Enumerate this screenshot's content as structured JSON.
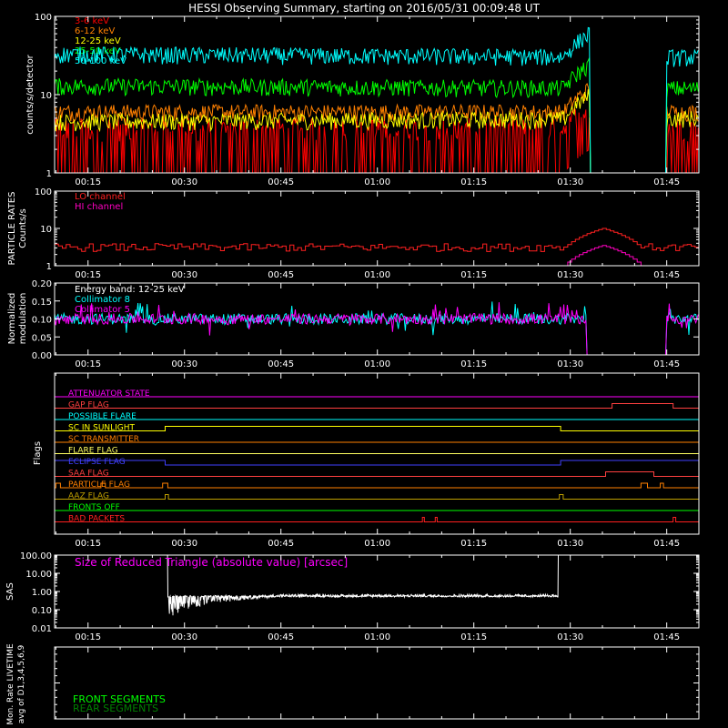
{
  "title": "HESSI Observing Summary, starting on 2016/05/31 00:09:48 UT",
  "time_ticks": [
    "00:15",
    "00:30",
    "00:45",
    "01:00",
    "01:15",
    "01:30",
    "01:45"
  ],
  "chart_data": [
    {
      "type": "line",
      "name": "counts",
      "ylabel": "counts/s/detector",
      "yscale": "log",
      "ylim": [
        1,
        100
      ],
      "yticks": [
        "1",
        "10",
        "100"
      ],
      "legend": "top-left",
      "data_gaps": [
        [
          "01:33",
          "01:45"
        ]
      ],
      "series": [
        {
          "name": "3-6 keV",
          "color": "#ff0000",
          "level_start": 2.5,
          "level_end": 2.5
        },
        {
          "name": "6-12 keV",
          "color": "#ff8000",
          "level_start": 6.0,
          "level_end": 6.0
        },
        {
          "name": "12-25 keV",
          "color": "#ffff00",
          "level_start": 4.5,
          "level_end": 5.0
        },
        {
          "name": "25-50 keV",
          "color": "#00ff00",
          "level_start": 13,
          "level_end": 12
        },
        {
          "name": "50-100 keV",
          "color": "#00ffff",
          "level_start": 33,
          "level_end": 30
        }
      ]
    },
    {
      "type": "line",
      "name": "particle-rates",
      "ylabel": "PARTICLE RATES",
      "ylabel2": "Counts/s",
      "yscale": "log",
      "ylim": [
        1,
        100
      ],
      "yticks": [
        "1",
        "10",
        "100"
      ],
      "legend": "top-left",
      "series": [
        {
          "name": "LO channel",
          "color": "#ff2020",
          "baseline": 3.0,
          "peak": 10.0,
          "peak_time": "01:35"
        },
        {
          "name": "HI channel",
          "color": "#ff00c0",
          "baseline": 1.0,
          "peak": 3.5,
          "peak_time": "01:35"
        }
      ]
    },
    {
      "type": "line",
      "name": "modulation",
      "ylabel": "Normalized",
      "ylabel2": "modulation",
      "ylim": [
        0,
        0.2
      ],
      "yticks": [
        "0.00",
        "0.05",
        "0.10",
        "0.15",
        "0.20"
      ],
      "annotation": "Energy band: 12-25 keV",
      "series": [
        {
          "name": "Collimator 8",
          "color": "#00ffff",
          "mean": 0.1
        },
        {
          "name": "Collimator 5",
          "color": "#ff00ff",
          "mean": 0.1
        }
      ]
    },
    {
      "type": "flags",
      "name": "flags",
      "ylabel": "Flags",
      "flags": [
        {
          "name": "ATTENUATOR STATE",
          "color": "#ff00ff"
        },
        {
          "name": "GAP FLAG",
          "color": "#ff4040"
        },
        {
          "name": "POSSIBLE FLARE",
          "color": "#00ffff"
        },
        {
          "name": "SC IN SUNLIGHT",
          "color": "#ffff00"
        },
        {
          "name": "SC TRANSMITTER",
          "color": "#ff8000"
        },
        {
          "name": "FLARE FLAG",
          "color": "#ffff60"
        },
        {
          "name": "ECLIPSE FLAG",
          "color": "#4040ff"
        },
        {
          "name": "SAA FLAG",
          "color": "#ff4040"
        },
        {
          "name": "PARTICLE FLAG",
          "color": "#ff8000"
        },
        {
          "name": "AAZ FLAG",
          "color": "#c0a000"
        },
        {
          "name": "FRONTS OFF",
          "color": "#00ff00"
        },
        {
          "name": "BAD PACKETS",
          "color": "#ff2020"
        }
      ]
    },
    {
      "type": "line",
      "name": "sas",
      "ylabel": "SAS",
      "yscale": "log",
      "ylim": [
        0.01,
        100
      ],
      "yticks": [
        "0.01",
        "0.10",
        "1.00",
        "10.00",
        "100.00"
      ],
      "annotation": "Size of Reduced Triangle (absolute value) [arcsec]",
      "annotation_color": "#ff00ff",
      "series": [
        {
          "name": "triangle",
          "color": "#ffffff"
        }
      ]
    },
    {
      "type": "line",
      "name": "livetime",
      "ylabel": "Mon. Rate LIVETIME",
      "ylabel2": "avg of D1,3,4,5,6,9",
      "ylim": [
        0,
        1
      ],
      "series": [
        {
          "name": "FRONT SEGMENTS",
          "color": "#00ff00"
        },
        {
          "name": "REAR SEGMENTS",
          "color": "#008000"
        }
      ]
    }
  ]
}
